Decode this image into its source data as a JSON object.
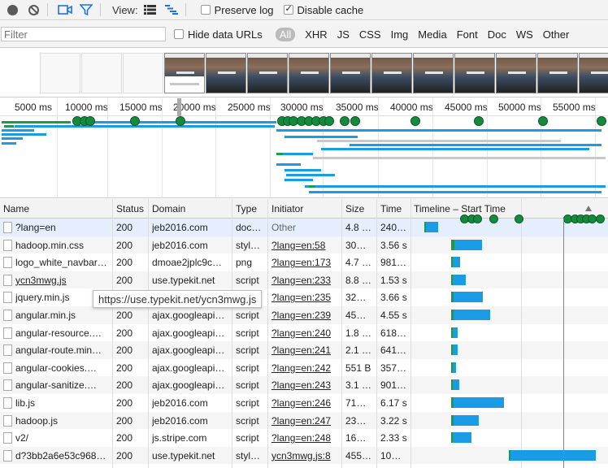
{
  "toolbar": {
    "view_label": "View:",
    "preserve_log": {
      "label": "Preserve log",
      "checked": false
    },
    "disable_cache": {
      "label": "Disable cache",
      "checked": true
    }
  },
  "filterbar": {
    "filter_placeholder": "Filter",
    "hide_data_urls": {
      "label": "Hide data URLs",
      "checked": false
    },
    "types": [
      "All",
      "XHR",
      "JS",
      "CSS",
      "Img",
      "Media",
      "Font",
      "Doc",
      "WS",
      "Other"
    ],
    "active_type": "All"
  },
  "overview": {
    "ticks": [
      "5000 ms",
      "10000 ms",
      "15000 ms",
      "20000 ms",
      "25000 ms",
      "30000 ms",
      "35000 ms",
      "40000 ms",
      "45000 ms",
      "50000 ms",
      "55000 ms"
    ]
  },
  "table": {
    "headers": {
      "name": "Name",
      "status": "Status",
      "domain": "Domain",
      "type": "Type",
      "initiator": "Initiator",
      "size": "Size",
      "time": "Time",
      "timeline": "Timeline – Start Time"
    },
    "rows": [
      {
        "name": "?lang=en",
        "status": "200",
        "domain": "jeb2016.com",
        "type": "doc…",
        "initiator": "Other",
        "size": "4.8 KB",
        "time": "240…",
        "start": 0.5,
        "wait": 0.3,
        "recv": 1.5
      },
      {
        "name": "hadoop.min.css",
        "status": "200",
        "domain": "jeb2016.com",
        "type": "styl…",
        "initiator": "?lang=en:58",
        "size": "30…",
        "time": "3.56 s",
        "start": 6.5,
        "wait": 0.7,
        "recv": 3.3
      },
      {
        "name": "logo_white_navbar…",
        "status": "200",
        "domain": "dmoae2jplc9c…",
        "type": "png",
        "initiator": "?lang=en:173",
        "size": "4.7 KB",
        "time": "981…",
        "start": 6.5,
        "wait": 0.4,
        "recv": 0.9
      },
      {
        "name": "ycn3mwg.js",
        "status": "200",
        "domain": "use.typekit.net",
        "type": "script",
        "initiator": "?lang=en:233",
        "size": "8.8 KB",
        "time": "1.53 s",
        "start": 6.5,
        "wait": 0.4,
        "recv": 1.5
      },
      {
        "name": "jquery.min.js",
        "status": "200",
        "domain": "ajax.googleapi…",
        "type": "script",
        "initiator": "?lang=en:235",
        "size": "32…",
        "time": "3.66 s",
        "start": 6.5,
        "wait": 0.5,
        "recv": 3.5
      },
      {
        "name": "angular.min.js",
        "status": "200",
        "domain": "ajax.googleapi…",
        "type": "script",
        "initiator": "?lang=en:239",
        "size": "45…",
        "time": "4.55 s",
        "start": 6.5,
        "wait": 0.5,
        "recv": 4.4
      },
      {
        "name": "angular-resource.…",
        "status": "200",
        "domain": "ajax.googleapi…",
        "type": "script",
        "initiator": "?lang=en:240",
        "size": "1.8 KB",
        "time": "618…",
        "start": 6.5,
        "wait": 0.3,
        "recv": 0.6
      },
      {
        "name": "angular-route.min…",
        "status": "200",
        "domain": "ajax.googleapi…",
        "type": "script",
        "initiator": "?lang=en:241",
        "size": "2.1 KB",
        "time": "641…",
        "start": 6.5,
        "wait": 0.3,
        "recv": 0.6
      },
      {
        "name": "angular-cookies.…",
        "status": "200",
        "domain": "ajax.googleapi…",
        "type": "script",
        "initiator": "?lang=en:242",
        "size": "551 B",
        "time": "357…",
        "start": 6.5,
        "wait": 0.2,
        "recv": 0.4
      },
      {
        "name": "angular-sanitize.…",
        "status": "200",
        "domain": "ajax.googleapi…",
        "type": "script",
        "initiator": "?lang=en:243",
        "size": "3.1 KB",
        "time": "901…",
        "start": 6.5,
        "wait": 0.3,
        "recv": 0.8
      },
      {
        "name": "lib.js",
        "status": "200",
        "domain": "jeb2016.com",
        "type": "script",
        "initiator": "?lang=en:246",
        "size": "71…",
        "time": "6.17 s",
        "start": 6.5,
        "wait": 0.6,
        "recv": 5.9
      },
      {
        "name": "hadoop.js",
        "status": "200",
        "domain": "jeb2016.com",
        "type": "script",
        "initiator": "?lang=en:247",
        "size": "23…",
        "time": "3.22 s",
        "start": 6.5,
        "wait": 0.5,
        "recv": 3.0
      },
      {
        "name": "v2/",
        "status": "200",
        "domain": "js.stripe.com",
        "type": "script",
        "initiator": "?lang=en:248",
        "size": "16…",
        "time": "2.33 s",
        "start": 6.5,
        "wait": 0.4,
        "recv": 2.2
      },
      {
        "name": "d?3bb2a6e53c968…",
        "status": "200",
        "domain": "use.typekit.net",
        "type": "styl…",
        "initiator": "ycn3mwg.js:8",
        "size": "455…",
        "time": "10…",
        "start": 19.5,
        "wait": 0.3,
        "recv": 10.0
      }
    ]
  },
  "tooltip": "https://use.typekit.net/ycn3mwg.js",
  "colors": {
    "waiting": "#1c9a48",
    "receiving": "#1a9be6",
    "load_line": "#e06060"
  }
}
